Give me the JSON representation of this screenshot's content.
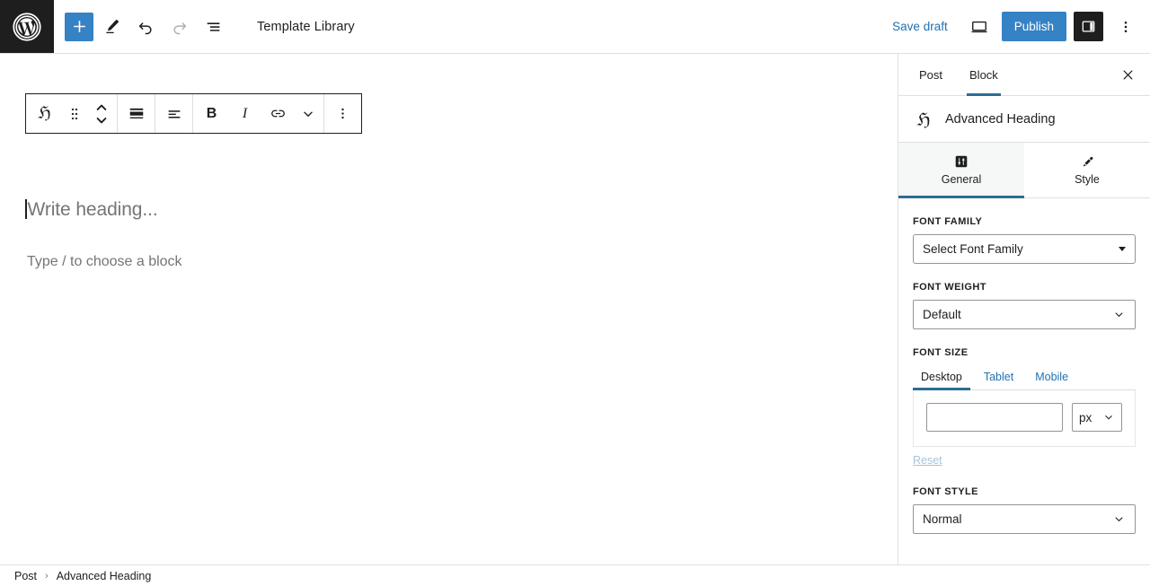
{
  "header": {
    "logo_icon": "wordpress-logo-icon",
    "tools": [
      {
        "name": "add-block-button",
        "icon": "plus-icon",
        "label": "Add block",
        "state": "primary"
      },
      {
        "name": "tools-button",
        "icon": "pencil-icon",
        "label": "Tools",
        "state": "normal"
      },
      {
        "name": "undo-button",
        "icon": "undo-icon",
        "label": "Undo",
        "state": "normal"
      },
      {
        "name": "redo-button",
        "icon": "redo-icon",
        "label": "Redo",
        "state": "disabled"
      },
      {
        "name": "list-view-button",
        "icon": "list-view-icon",
        "label": "List view",
        "state": "normal"
      }
    ],
    "document_title": "Template Library",
    "save_draft_label": "Save draft",
    "preview_icon": "desktop-preview-icon",
    "publish_label": "Publish",
    "sidebar_toggle_icon": "sidebar-panel-icon",
    "more_options_icon": "vertical-dots-icon",
    "accent_blue": "#3582c4",
    "link_blue": "#2271b1"
  },
  "block_toolbar": {
    "groups": [
      [
        {
          "name": "block-type-button",
          "icon": "advanced-heading-icon",
          "label": "ℌ"
        },
        {
          "name": "drag-handle-button",
          "icon": "drag-dots-icon"
        },
        {
          "name": "move-block-button",
          "icon": "move-up-down-icon"
        }
      ],
      [
        {
          "name": "change-block-alignment-button",
          "icon": "block-align-icon"
        }
      ],
      [
        {
          "name": "change-text-alignment-button",
          "icon": "text-align-icon"
        }
      ],
      [
        {
          "name": "bold-button",
          "icon": "bold-icon",
          "label": "B"
        },
        {
          "name": "italic-button",
          "icon": "italic-icon",
          "label": "I"
        },
        {
          "name": "link-button",
          "icon": "link-icon"
        },
        {
          "name": "more-rich-text-button",
          "icon": "chevron-down-icon"
        }
      ],
      [
        {
          "name": "block-options-button",
          "icon": "vertical-dots-icon"
        }
      ]
    ]
  },
  "editor": {
    "heading_placeholder": "Write heading...",
    "paragraph_placeholder": "Type / to choose a block"
  },
  "sidebar": {
    "tabs": [
      {
        "label": "Post",
        "active": false
      },
      {
        "label": "Block",
        "active": true
      }
    ],
    "close_icon": "close-icon",
    "block": {
      "glyph": "ℌ",
      "icon": "advanced-heading-icon",
      "name": "Advanced Heading"
    },
    "subtabs": [
      {
        "label": "General",
        "icon": "sliders-icon",
        "active": true
      },
      {
        "label": "Style",
        "icon": "paintbrush-icon",
        "active": false
      }
    ],
    "fields": {
      "font_family": {
        "label": "FONT FAMILY",
        "value": "Select Font Family",
        "control": "select"
      },
      "font_weight": {
        "label": "FONT WEIGHT",
        "value": "Default",
        "control": "select"
      },
      "font_size": {
        "label": "FONT SIZE",
        "devices": [
          {
            "label": "Desktop",
            "active": true
          },
          {
            "label": "Tablet",
            "active": false
          },
          {
            "label": "Mobile",
            "active": false
          }
        ],
        "value": "",
        "placeholder": "",
        "unit": "px",
        "reset_label": "Reset"
      },
      "font_style": {
        "label": "FONT STYLE",
        "value": "Normal",
        "control": "select"
      }
    },
    "accent_underline": "#2c6d94"
  },
  "footer": {
    "breadcrumb": [
      {
        "label": "Post"
      },
      {
        "label": "Advanced Heading"
      }
    ],
    "separator": "›"
  }
}
